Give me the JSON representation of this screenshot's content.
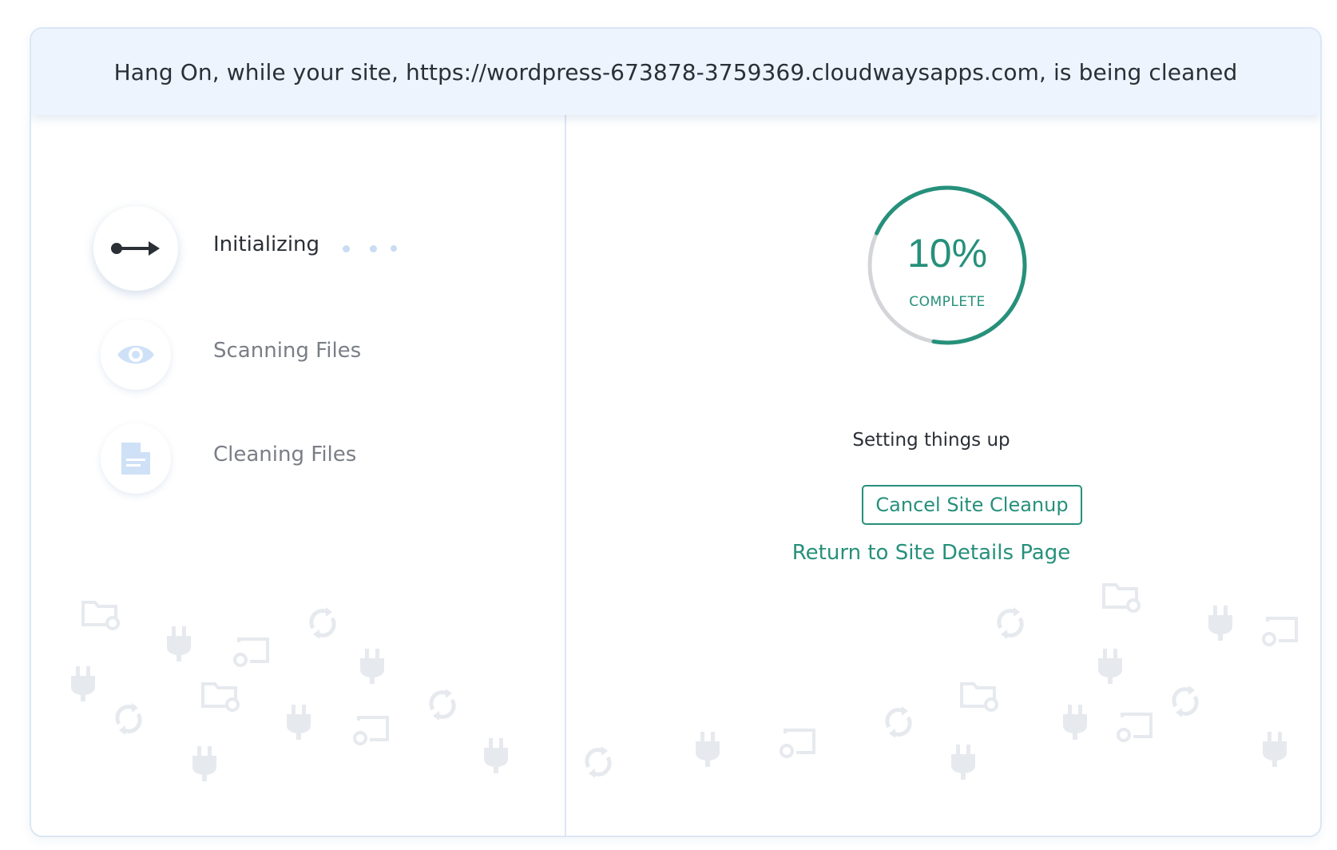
{
  "banner": {
    "text": "Hang On, while your site, https://wordpress-673878-3759369.cloudwaysapps.com, is being cleaned"
  },
  "steps": [
    {
      "label": "Initializing",
      "icon": "arrow-right-icon",
      "state": "active"
    },
    {
      "label": "Scanning Files",
      "icon": "eye-icon",
      "state": "pending"
    },
    {
      "label": "Cleaning Files",
      "icon": "document-icon",
      "state": "pending"
    }
  ],
  "progress": {
    "value": 10,
    "value_text": "10%",
    "subtitle": "COMPLETE"
  },
  "status_text": "Setting things up",
  "actions": {
    "cancel_label": "Cancel Site Cleanup",
    "return_label": "Return to Site Details Page"
  },
  "colors": {
    "accent": "#26907b",
    "banner_bg": "#edf4fd",
    "border": "#dbe7f6",
    "track": "#d3d5d8",
    "pending_icon": "#cfe1f7",
    "background_icon": "#e6e9ee"
  },
  "background_icons": [
    "folder-sync-icon",
    "plug-icon",
    "sync-icon",
    "screen-sync-icon"
  ]
}
